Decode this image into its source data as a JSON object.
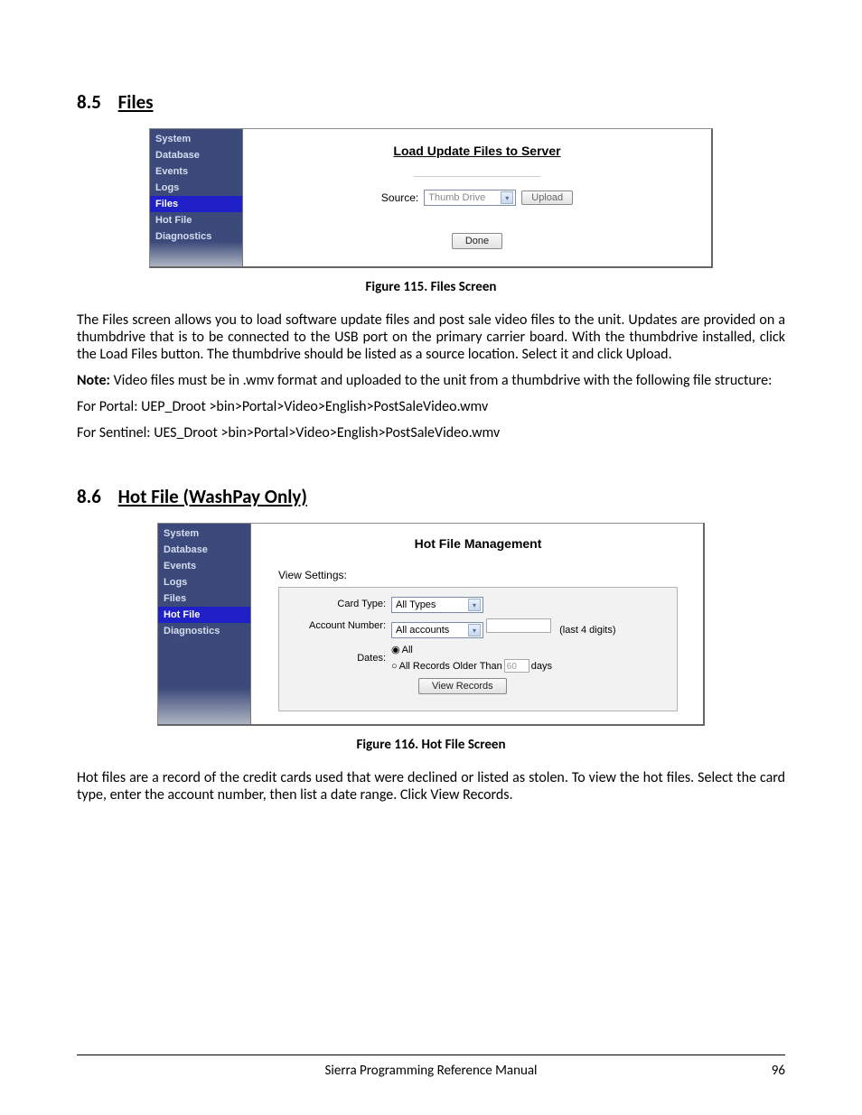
{
  "sections": {
    "s1": {
      "number": "8.5",
      "title": "Files",
      "caption": "Figure 115. Files Screen",
      "para1": "The Files screen allows you to load software update files and post sale video files to the unit. Updates are provided on a thumbdrive that is to be connected to the USB port on the primary carrier board. With the thumbdrive installed, click the Load Files button. The thumbdrive should be listed as a source location. Select it and click Upload.",
      "note_label": "Note:",
      "note_text": " Video files must be in .wmv format and uploaded to the unit from a thumbdrive with the following file structure:",
      "path1": "For Portal: UEP_Droot >bin>Portal>Video>English>PostSaleVideo.wmv",
      "path2": " For Sentinel: UES_Droot >bin>Portal>Video>English>PostSaleVideo.wmv"
    },
    "s2": {
      "number": "8.6",
      "title": "Hot File (WashPay Only)",
      "caption": "Figure 116. Hot File Screen",
      "para1": "Hot files are a record of the credit cards used that were declined or listed as stolen. To view the hot files. Select the card type, enter the account number, then list a date range. Click View Records."
    }
  },
  "screens": {
    "files": {
      "title": "Load Update Files to Server",
      "source_label": "Source:",
      "source_value": "Thumb Drive",
      "upload_label": "Upload",
      "done_label": "Done",
      "sidebar": [
        "System",
        "Database",
        "Events",
        "Logs",
        "Files",
        "Hot File",
        "Diagnostics"
      ],
      "selected": "Files"
    },
    "hotfile": {
      "title": "Hot File Management",
      "view_settings_label": "View Settings:",
      "card_type_label": "Card Type:",
      "card_type_value": "All Types",
      "account_label": "Account Number:",
      "account_value": "All accounts",
      "account_hint": "(last 4 digits)",
      "dates_label": "Dates:",
      "radio_all": "All",
      "radio_older": "All Records Older Than",
      "days_value": "60",
      "days_label": "days",
      "view_records_label": "View Records",
      "sidebar": [
        "System",
        "Database",
        "Events",
        "Logs",
        "Files",
        "Hot File",
        "Diagnostics"
      ],
      "selected": "Hot File"
    }
  },
  "footer": {
    "title": "Sierra Programming Reference Manual",
    "page": "96"
  }
}
